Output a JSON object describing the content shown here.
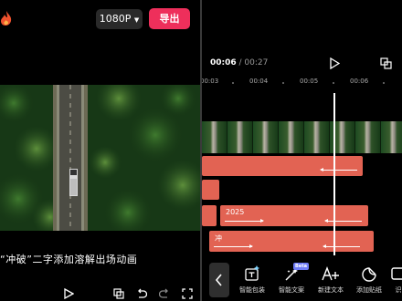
{
  "left": {
    "resolution_label": "1080P",
    "export_label": "导出",
    "subtitle": "“冲破”二字添加溶解出场动画"
  },
  "right": {
    "current_time": "00:06",
    "time_separator": " / ",
    "total_time": "00:27",
    "ruler": [
      "00:03",
      "00:04",
      "00:05",
      "00:06"
    ],
    "tracks": {
      "text_track_label": "2025",
      "sticker_track_label": "冲"
    },
    "tools": [
      {
        "label": "智能包装",
        "icon": "smart-package-icon"
      },
      {
        "label": "智能文案",
        "icon": "smart-copywriting-icon",
        "badge": "Beta"
      },
      {
        "label": "新建文本",
        "icon": "new-text-icon"
      },
      {
        "label": "添加贴纸",
        "icon": "add-sticker-icon"
      },
      {
        "label": "识",
        "icon": "recognize-icon"
      }
    ]
  },
  "colors": {
    "export": "#ee2f5b",
    "track": "#e26353",
    "beta": "#6f7cf6"
  }
}
